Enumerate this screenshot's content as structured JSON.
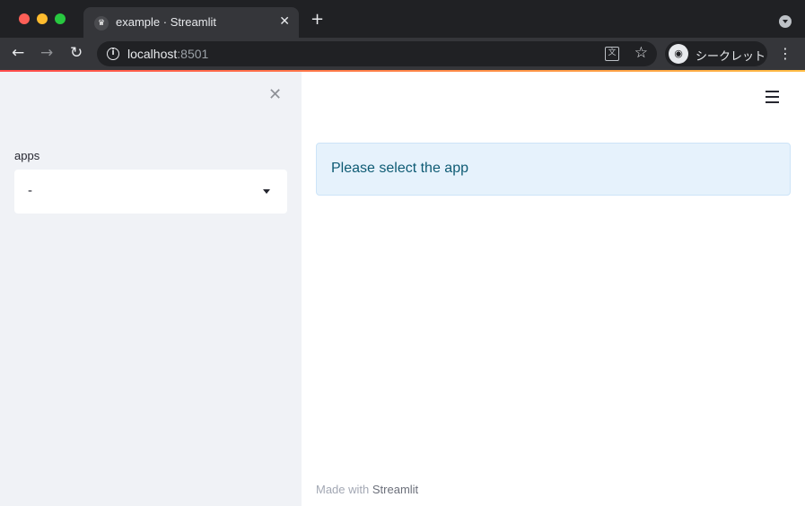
{
  "browser": {
    "tab": {
      "favicon": "♛",
      "title": "example · Streamlit",
      "close_glyph": "✕"
    },
    "new_tab_glyph": "+",
    "nav": {
      "back_glyph": "←",
      "forward_glyph": "→",
      "reload_glyph": "↻"
    },
    "omnibox": {
      "host": "localhost",
      "port": ":8501"
    },
    "translate_glyph": "文",
    "star_glyph": "☆",
    "profile": {
      "icon_glyph": "◉",
      "label": "シークレット"
    },
    "menu_glyph": "⋮"
  },
  "sidebar": {
    "close_glyph": "✕",
    "select": {
      "label": "apps",
      "value": "-"
    }
  },
  "main": {
    "info_message": "Please select the app",
    "footer": {
      "prefix": "Made with ",
      "link": "Streamlit"
    }
  },
  "colors": {
    "sidebar_bg": "#f0f2f6",
    "info_bg": "#e6f2fc",
    "info_text": "#0e5b74",
    "accent_gradient_start": "#ff4b4b",
    "accent_gradient_end": "#ffbd45"
  }
}
